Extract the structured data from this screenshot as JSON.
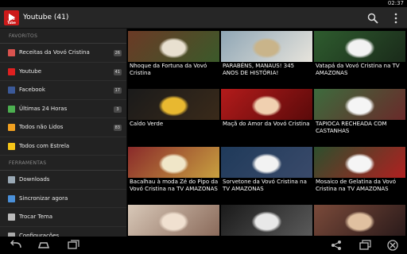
{
  "status_bar": {
    "time": "02:37"
  },
  "action_bar": {
    "title": "Youtube (41)",
    "icon_text": "You Tube"
  },
  "sidebar": {
    "sections": [
      {
        "header": "FAVORITOS",
        "items": [
          {
            "label": "Receitas da Vovó Cristina",
            "badge": "26",
            "icon_color": "#d9534f"
          },
          {
            "label": "Youtube",
            "badge": "41",
            "icon_color": "#e02020"
          },
          {
            "label": "Facebook",
            "badge": "17",
            "icon_color": "#3b5998"
          },
          {
            "label": "Últimas 24 Horas",
            "badge": "3",
            "icon_color": "#4caf50"
          },
          {
            "label": "Todos não Lidos",
            "badge": "83",
            "icon_color": "#f0a020"
          },
          {
            "label": "Todos com Estrela",
            "badge": "",
            "icon_color": "#f5c518"
          }
        ]
      },
      {
        "header": "FERRAMENTAS",
        "items": [
          {
            "label": "Downloads",
            "icon_color": "#9aa9b5"
          },
          {
            "label": "Sincronizar agora",
            "icon_color": "#4a90d9"
          },
          {
            "label": "Trocar Tema",
            "icon_color": "#bbbbbb"
          },
          {
            "label": "Configurações",
            "icon_color": "#aaaaaa"
          }
        ]
      }
    ]
  },
  "videos": [
    {
      "caption": "Nhoque da Fortuna da Vovó Cristina",
      "colors": [
        "#6b3a26",
        "#e8e0d0",
        "#3b5a2a"
      ]
    },
    {
      "caption": "PARABÉNS, MANAUS! 345 ANOS DE HISTÓRIA!",
      "colors": [
        "#8fa6b5",
        "#c9b48a",
        "#e7e4dc"
      ]
    },
    {
      "caption": "Vatapá da Vovó Cristina na TV AMAZONAS",
      "colors": [
        "#2e5c2e",
        "#f2f2f2",
        "#1a2a1a"
      ]
    },
    {
      "caption": "Caldo Verde",
      "colors": [
        "#1a1a1a",
        "#e8b830",
        "#3a2a1a"
      ]
    },
    {
      "caption": "Maçã do Amor da Vovó Cristina",
      "colors": [
        "#b31b1b",
        "#f0d0b0",
        "#5a0a0a"
      ]
    },
    {
      "caption": "TAPIOCA RECHEADA COM CASTANHAS",
      "colors": [
        "#3d6b3d",
        "#f5f5f5",
        "#6a2a2a"
      ]
    },
    {
      "caption": "Bacalhau à moda Zé do Pipo da Vovó Cristina na TV AMAZONAS",
      "colors": [
        "#8a2a2a",
        "#f0e6c8",
        "#c8a040"
      ]
    },
    {
      "caption": "Sorvetone da Vovó Cristina na TV AMAZONAS",
      "colors": [
        "#1f3a5a",
        "#f2f2f2",
        "#3a4a6a"
      ]
    },
    {
      "caption": "Mosaico de Gelatina da Vovó Cristina na TV AMAZONAS",
      "colors": [
        "#2d4f2d",
        "#f5f5f5",
        "#b02020"
      ]
    },
    {
      "caption": "",
      "colors": [
        "#d8c8b8",
        "#f0e0d0",
        "#8a6a5a"
      ]
    },
    {
      "caption": "",
      "colors": [
        "#1a1a1a",
        "#e8e8e8",
        "#5a5a5a"
      ]
    },
    {
      "caption": "",
      "colors": [
        "#7a4a3a",
        "#e0c0a0",
        "#2a1a1a"
      ]
    }
  ]
}
